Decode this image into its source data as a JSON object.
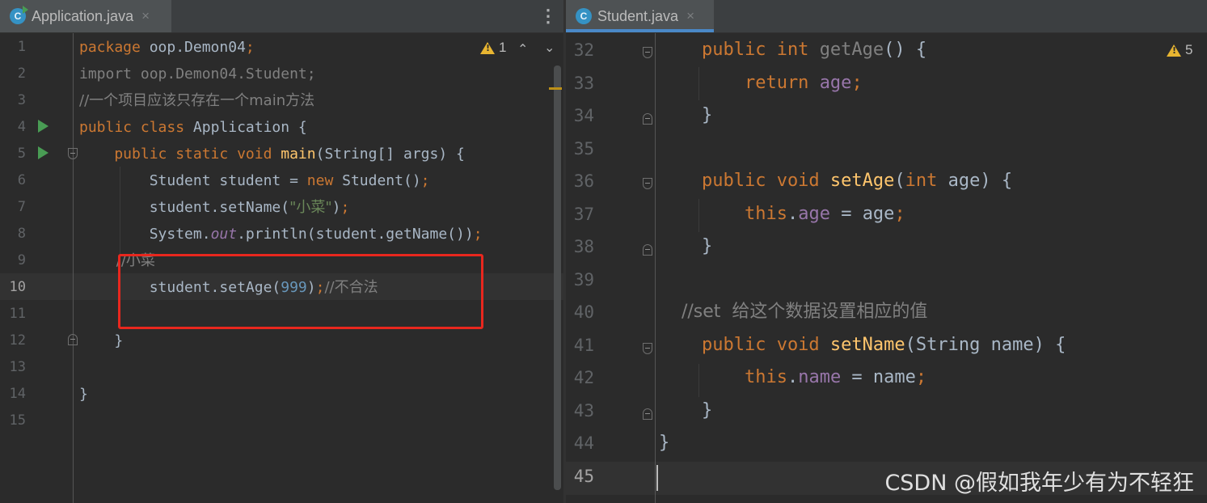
{
  "left_editor": {
    "tab": {
      "label": "Application.java",
      "close": "×",
      "icon": "java-class-runnable-icon"
    },
    "menu_icon": "⋮",
    "warnings": {
      "count": "1"
    },
    "nav": {
      "up": "⌃",
      "down": "⌄"
    },
    "lines": [
      {
        "num": "1",
        "segments": [
          {
            "t": "package ",
            "c": "kw"
          },
          {
            "t": "oop.Demon04",
            "c": ""
          },
          {
            "t": ";",
            "c": "sym"
          }
        ]
      },
      {
        "num": "2",
        "segments": [
          {
            "t": "import oop.Demon04.Student;",
            "c": "unused"
          }
        ]
      },
      {
        "num": "3",
        "segments": [
          {
            "t": "//一个项目应该只存在一个main方法",
            "c": "cmt"
          }
        ]
      },
      {
        "num": "4",
        "segments": [
          {
            "t": "public class ",
            "c": "kw"
          },
          {
            "t": "Application {",
            "c": ""
          }
        ]
      },
      {
        "num": "5",
        "segments": [
          {
            "t": "    public static void ",
            "c": "kw"
          },
          {
            "t": "main",
            "c": "fn"
          },
          {
            "t": "(String[] args) {",
            "c": ""
          }
        ]
      },
      {
        "num": "6",
        "segments": [
          {
            "t": "        Student student = ",
            "c": ""
          },
          {
            "t": "new ",
            "c": "kw"
          },
          {
            "t": "Student()",
            "c": ""
          },
          {
            "t": ";",
            "c": "sym"
          }
        ]
      },
      {
        "num": "7",
        "segments": [
          {
            "t": "        student.setName(",
            "c": ""
          },
          {
            "t": "\"小菜\"",
            "c": "str"
          },
          {
            "t": ")",
            "c": ""
          },
          {
            "t": ";",
            "c": "sym"
          }
        ]
      },
      {
        "num": "8",
        "segments": [
          {
            "t": "        System.",
            "c": ""
          },
          {
            "t": "out",
            "c": "fldi"
          },
          {
            "t": ".println(student.getName())",
            "c": ""
          },
          {
            "t": ";",
            "c": "sym"
          }
        ]
      },
      {
        "num": "9",
        "segments": [
          {
            "t": "        //小菜",
            "c": "cmt"
          }
        ]
      },
      {
        "num": "10",
        "segments": [
          {
            "t": "        student.setAge(",
            "c": ""
          },
          {
            "t": "999",
            "c": "num"
          },
          {
            "t": ")",
            "c": ""
          },
          {
            "t": ";",
            "c": "sym"
          },
          {
            "t": "//不合法",
            "c": "cmt"
          }
        ]
      },
      {
        "num": "11",
        "segments": []
      },
      {
        "num": "12",
        "segments": [
          {
            "t": "    }",
            "c": ""
          }
        ]
      },
      {
        "num": "13",
        "segments": []
      },
      {
        "num": "14",
        "segments": [
          {
            "t": "}",
            "c": ""
          }
        ]
      },
      {
        "num": "15",
        "segments": []
      }
    ]
  },
  "right_editor": {
    "tab": {
      "label": "Student.java",
      "close": "×",
      "icon": "java-class-icon"
    },
    "warnings": {
      "count": "5"
    },
    "lines": [
      {
        "num": "32",
        "segments": [
          {
            "t": "    public int ",
            "c": "kw"
          },
          {
            "t": "getAge",
            "c": "unused"
          },
          {
            "t": "() {",
            "c": ""
          }
        ]
      },
      {
        "num": "33",
        "segments": [
          {
            "t": "        return ",
            "c": "kw"
          },
          {
            "t": "age",
            "c": "fld"
          },
          {
            "t": ";",
            "c": "sym"
          }
        ]
      },
      {
        "num": "34",
        "segments": [
          {
            "t": "    }",
            "c": ""
          }
        ]
      },
      {
        "num": "35",
        "segments": []
      },
      {
        "num": "36",
        "segments": [
          {
            "t": "    public void ",
            "c": "kw"
          },
          {
            "t": "setAge",
            "c": "fn"
          },
          {
            "t": "(",
            "c": ""
          },
          {
            "t": "int ",
            "c": "kw"
          },
          {
            "t": "age) {",
            "c": ""
          }
        ]
      },
      {
        "num": "37",
        "segments": [
          {
            "t": "        this",
            "c": "kw"
          },
          {
            "t": ".",
            "c": ""
          },
          {
            "t": "age",
            "c": "fld"
          },
          {
            "t": " = age",
            "c": ""
          },
          {
            "t": ";",
            "c": "sym"
          }
        ]
      },
      {
        "num": "38",
        "segments": [
          {
            "t": "    }",
            "c": ""
          }
        ]
      },
      {
        "num": "39",
        "segments": []
      },
      {
        "num": "40",
        "segments": [
          {
            "t": "    //set  给这个数据设置相应的值",
            "c": "cmt"
          }
        ]
      },
      {
        "num": "41",
        "segments": [
          {
            "t": "    public void ",
            "c": "kw"
          },
          {
            "t": "setName",
            "c": "fn"
          },
          {
            "t": "(String name) {",
            "c": ""
          }
        ]
      },
      {
        "num": "42",
        "segments": [
          {
            "t": "        this",
            "c": "kw"
          },
          {
            "t": ".",
            "c": ""
          },
          {
            "t": "name",
            "c": "fld"
          },
          {
            "t": " = name",
            "c": ""
          },
          {
            "t": ";",
            "c": "sym"
          }
        ]
      },
      {
        "num": "43",
        "segments": [
          {
            "t": "    }",
            "c": ""
          }
        ]
      },
      {
        "num": "44",
        "segments": [
          {
            "t": "}",
            "c": ""
          }
        ]
      },
      {
        "num": "45",
        "segments": []
      }
    ]
  },
  "colors": {
    "keyword": "#cc7832",
    "string": "#6a8759",
    "number": "#6897bb",
    "field": "#9876aa",
    "method": "#ffc66d",
    "comment": "#808080",
    "highlight_box": "#e8271e",
    "warning": "#e8b531"
  },
  "watermark": "CSDN @假如我年少有为不轻狂"
}
